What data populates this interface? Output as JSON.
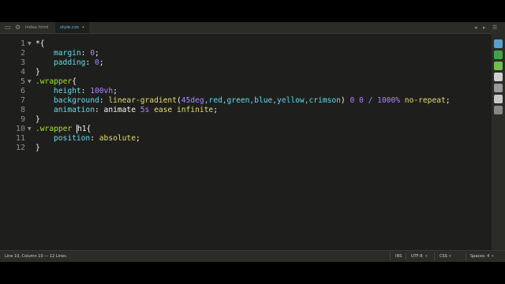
{
  "tabs": [
    {
      "label": "index.html",
      "active": false
    },
    {
      "label": "style.css",
      "active": true,
      "close": "•"
    }
  ],
  "window_controls": [
    "◂",
    "▸",
    "☰"
  ],
  "line_numbers": [
    "1",
    "2",
    "3",
    "4",
    "5",
    "6",
    "7",
    "8",
    "9",
    "10",
    "11",
    "12"
  ],
  "code": {
    "l1": {
      "sel": "*",
      "punc": "{"
    },
    "l2": {
      "prop": "margin",
      "sep": ": ",
      "num": "0",
      "end": ";"
    },
    "l3": {
      "prop": "padding",
      "sep": ": ",
      "num": "0",
      "end": ";"
    },
    "l4": {
      "punc": "}"
    },
    "l5": {
      "sel": ".wrapper",
      "punc": "{"
    },
    "l6": {
      "prop": "height",
      "sep": ": ",
      "num": "100vh",
      "end": ";"
    },
    "l7": {
      "prop": "background",
      "sep": ": ",
      "fn": "linear-gradient",
      "open": "(",
      "deg": "45deg",
      "c1": ",red,green,blue,yellow,crimson",
      "close": ")",
      "nums": " 0 0 / 1000%",
      "kw": " no-repeat",
      "end": ";"
    },
    "l8": {
      "prop": "animation",
      "sep": ": ",
      "name": "animate ",
      "num": "5s",
      "rest": " ease infinite",
      "end": ";"
    },
    "l9": {
      "punc": "}"
    },
    "l10": {
      "sel": ".wrapper ",
      "cur": "h1",
      "punc": "{"
    },
    "l11": {
      "prop": "position",
      "sep": ": ",
      "val": "absolute",
      "end": ";"
    },
    "l12": {
      "punc": "}"
    }
  },
  "status": {
    "left": "Line 10, Column 10 — 12 Lines",
    "ins": "INS",
    "encoding": "UTF-8",
    "syntax": "CSS",
    "spaces": "Spaces: 4"
  },
  "colors": {
    "background": "#1e1f1c",
    "accent": "#6bb6ff",
    "property": "#66d9ef",
    "number": "#ae81ff",
    "function": "#a6e22e"
  }
}
